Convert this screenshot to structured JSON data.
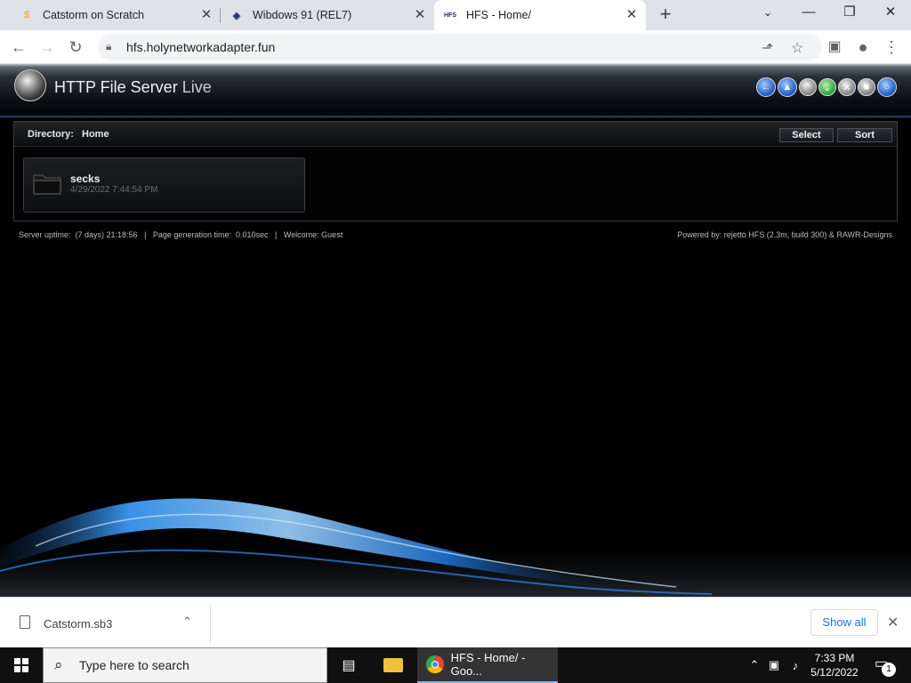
{
  "browser": {
    "tabs": [
      {
        "title": "Catstorm on Scratch",
        "favicon": "scratch-cat-icon",
        "active": false
      },
      {
        "title": "Wibdows 91 (REL7)",
        "favicon": "wibdows-icon",
        "active": false
      },
      {
        "title": "HFS - Home/",
        "favicon": "hfs-icon",
        "favicon_text": "HFS",
        "active": true
      }
    ],
    "url": "hfs.holynetworkadapter.fun"
  },
  "hfs": {
    "title_main": "HTTP File Server",
    "title_live": "Live",
    "directory_label": "Directory:",
    "directory_value": "Home",
    "select_label": "Select",
    "sort_label": "Sort",
    "items": [
      {
        "name": "secks",
        "date": "4/29/2022 7:44:54 PM",
        "type": "folder"
      }
    ],
    "footer_left": "Server uptime:  (7 days) 21:18:56   |   Page generation time:  0.010sec   |   Welcome: Guest",
    "footer_right": "Powered by: rejetto HFS (2.3m, build 300) & RAWR-Designs"
  },
  "downloads": {
    "file_name": "Catstorm.sb3",
    "show_all_label": "Show all"
  },
  "taskbar": {
    "search_placeholder": "Type here to search",
    "active_task_label": "HFS - Home/ - Goo...",
    "time": "7:33 PM",
    "date": "5/12/2022",
    "notification_count": "1"
  }
}
